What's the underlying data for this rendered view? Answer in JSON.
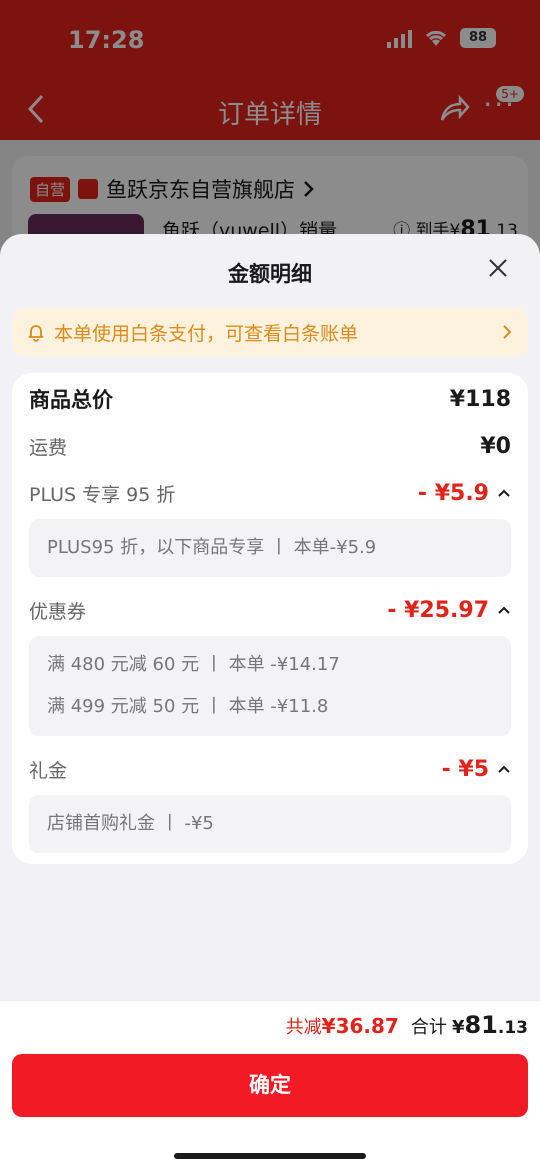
{
  "status": {
    "time": "17:28",
    "battery": "88"
  },
  "nav": {
    "title": "订单详情",
    "badge": "5+"
  },
  "background": {
    "self_tag": "自营",
    "shop_name": "鱼跃京东自营旗舰店",
    "product_name": "鱼跃（yuwell）销量...",
    "price_prefix": "到手¥",
    "price_int": "81",
    "price_dec": ".13"
  },
  "sheet": {
    "title": "金额明细",
    "notice": "本单使用白条支付，可查看白条账单",
    "goods_total": {
      "label": "商品总价",
      "value": "¥118"
    },
    "shipping": {
      "label": "运费",
      "value": "¥0"
    },
    "plus": {
      "label": "PLUS 专享 95 折",
      "value": "- ¥5.9",
      "lines": [
        "PLUS95 折，以下商品专享 丨 本单-¥5.9"
      ]
    },
    "coupon": {
      "label": "优惠券",
      "value": "- ¥25.97",
      "lines": [
        "满 480 元减 60 元 丨 本单 -¥14.17",
        "满 499 元减 50 元 丨 本单 -¥11.8"
      ]
    },
    "gift": {
      "label": "礼金",
      "value": "- ¥5",
      "lines": [
        "店铺首购礼金 丨 -¥5"
      ]
    }
  },
  "footer": {
    "saved_label": "共减",
    "saved_value": "¥36.87",
    "total_label": "合计",
    "total_symbol": "¥",
    "total_int": "81",
    "total_dec": ".13",
    "confirm": "确定"
  },
  "colors": {
    "brand_red": "#e2231a",
    "notice_orange": "#e08a18",
    "button_red": "#f21a24"
  }
}
